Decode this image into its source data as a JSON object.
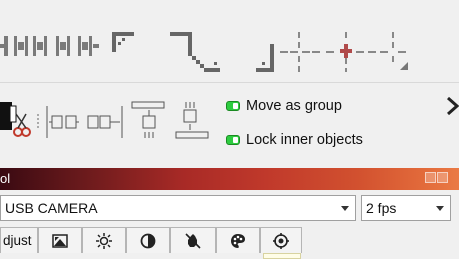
{
  "toolbar_top": {
    "icons": [
      "distribute-vertical-icon",
      "distribute-vertical-2-icon",
      "top-left-corner-icon",
      "top-right-corner-icon",
      "bottom-left-corner-icon",
      "grid-cross-icon",
      "grid-cross-center-icon"
    ]
  },
  "toolbar_options": {
    "move_as_group": "Move as group",
    "lock_inner_objects": "Lock inner objects"
  },
  "panel": {
    "title": "ol",
    "camera_select": "USB CAMERA",
    "fps_select": "2 fps",
    "tabs": [
      "djust",
      "image-icon",
      "brightness-icon",
      "contrast-icon",
      "saturation-icon",
      "palette-icon",
      "target-icon"
    ]
  }
}
